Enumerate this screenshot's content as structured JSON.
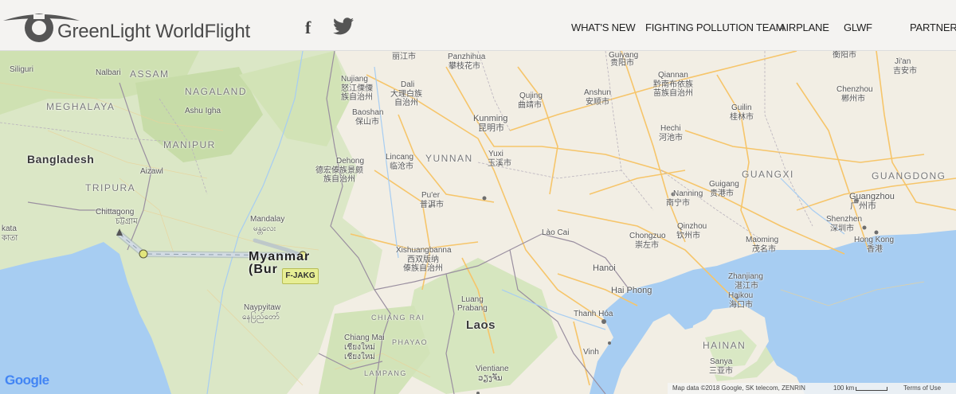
{
  "brand": {
    "name": "GreenLight WorldFlight"
  },
  "social": {
    "facebook_icon": "facebook-icon",
    "twitter_icon": "twitter-icon"
  },
  "nav": {
    "items": [
      "WHAT'S NEW",
      "FIGHTING POLLUTION TEAM",
      "AIRPLANE",
      "GLWF",
      "PARTNERS"
    ]
  },
  "colors": {
    "land": "#f2eee4",
    "forest": "#d9e8c4",
    "water": "#a7cdf2",
    "roads": "#f6c56a",
    "border": "#9a8fa0",
    "flight_path": "#c9d3de",
    "aircraft_tag": "#e7ee94"
  },
  "map": {
    "aircraft_tag": "F-JAKG",
    "labels": {
      "siliguri": "Siliguri",
      "nalbari": "Nalbari",
      "assam": "ASSAM",
      "meghalaya": "MEGHALAYA",
      "nagaland": "NAGALAND",
      "ashu_igha": "Ashu Igha",
      "manipur": "MANIPUR",
      "bangladesh": "Bangladesh",
      "tripura": "TRIPURA",
      "aizawl": "Aizawl",
      "chittagong": "Chittagong",
      "chittagong_local": "চট্টগ্রাম",
      "kata": "kata",
      "kata_local": "কাতা",
      "mandalay": "Mandalay",
      "mandalay_local": "မန္တလေး",
      "myanmar": "Myanmar",
      "burma": "(Bur",
      "naypyitaw": "Naypyitaw",
      "naypyitaw_local": "နေပြည်တော်",
      "chiang_rai": "CHIANG RAI",
      "phayao": "PHAYAO",
      "chiang_mai": "Chiang Mai",
      "chiang_mai_local": "เชียงใหม่",
      "chiang_mai_region": "เชียงใหม่",
      "lampang": "LAMPANG",
      "lijiang": "丽江市",
      "panzhihua": "Panzhihua",
      "panzhihua_local": "攀枝花市",
      "nujiang": "Nujiang",
      "nujiang_local": "怒江傈僳\n族自治州",
      "dali": "Dali",
      "dali_local": "大理白族\n自治州",
      "baoshan": "Baoshan",
      "baoshan_local": "保山市",
      "dehong": "Dehong",
      "dehong_local": "德宏傣族景颇\n族自治州",
      "lincang": "Lincang",
      "lincang_local": "临沧市",
      "yunnan": "YUNNAN",
      "kunming": "Kunming",
      "kunming_local": "昆明市",
      "yuxi": "Yuxi",
      "yuxi_local": "玉溪市",
      "puer": "Pu'er",
      "puer_local": "普洱市",
      "xishuangbanna": "Xishuangbanna",
      "xishuangbanna_local": "西双版纳\n傣族自治州",
      "qujing": "Qujing",
      "qujing_local": "曲靖市",
      "guiyang": "Guiyang",
      "guiyang_local": "贵阳市",
      "qiannan": "Qiannan",
      "qiannan_local": "黔南布依族\n苗族自治州",
      "anshun": "Anshun",
      "anshun_local": "安顺市",
      "hechi": "Hechi",
      "hechi_local": "河池市",
      "guilin": "Guilin",
      "guilin_local": "桂林市",
      "guangxi": "GUANGXI",
      "nanning": "Nanning",
      "nanning_local": "南宁市",
      "guigang": "Guigang",
      "guigang_local": "贵港市",
      "chongzuo": "Chongzuo",
      "chongzuo_local": "崇左市",
      "qinzhou": "Qinzhou",
      "qinzhou_local": "钦州市",
      "maoming": "Maoming",
      "maoming_local": "茂名市",
      "zhanjiang": "Zhanjiang",
      "zhanjiang_local": "湛江市",
      "haikou": "Haikou",
      "haikou_local": "海口市",
      "hainan": "HAINAN",
      "sanya": "Sanya",
      "sanya_local": "三亚市",
      "hengyang": "衡阳市",
      "jian": "Ji'an",
      "jian_local": "吉安市",
      "chenzhou": "Chenzhou",
      "chenzhou_local": "郴州市",
      "guangdong": "GUANGDONG",
      "guangzhou": "Guangzhou",
      "guangzhou_local": "广州市",
      "shenzhen": "Shenzhen",
      "shenzhen_local": "深圳市",
      "hong_kong": "Hong Kong",
      "hong_kong_local": "香港",
      "lao_cai": "Lào Cai",
      "hanoi": "Hanoi",
      "hai_phong": "Hai Phong",
      "thanh_hoa": "Thanh Hóa",
      "vinh": "Vinh",
      "laos": "Laos",
      "luang_prabang": "Luang\nPrabang",
      "vientiane": "Vientiane",
      "vientiane_local": "ວຽງຈັນ"
    }
  },
  "footer": {
    "google": "Google",
    "attribution": "Map data ©2018 Google, SK telecom, ZENRIN",
    "scale": "100 km",
    "terms": "Terms of Use"
  }
}
